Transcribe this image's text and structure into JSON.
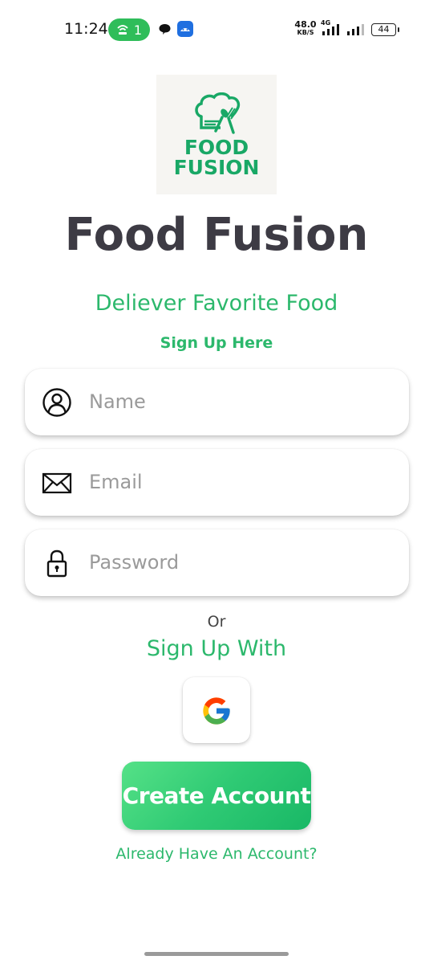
{
  "status_bar": {
    "time": "11:24",
    "hotspot_count": "1",
    "net_speed": "48.0",
    "net_speed_unit": "KB/S",
    "network_type": "4G",
    "battery": "44"
  },
  "logo": {
    "line1": "FOOD",
    "line2": "FUSION",
    "brand_color": "#19a866"
  },
  "app_title": "Food Fusion",
  "tagline": "Deliever Favorite Food",
  "signup_heading": "Sign Up Here",
  "form": {
    "name": {
      "placeholder": "Name",
      "icon": "user-circle-icon"
    },
    "email": {
      "placeholder": "Email",
      "icon": "envelope-icon"
    },
    "password": {
      "placeholder": "Password",
      "icon": "lock-icon"
    }
  },
  "or_text": "Or",
  "signup_with": "Sign Up With",
  "social": {
    "google_icon": "google-icon"
  },
  "create_account_label": "Create Account",
  "have_account_link": "Already Have An Account?",
  "colors": {
    "accent": "#2cb86c",
    "title": "#3d3b44",
    "button_start": "#55e187",
    "button_end": "#19b866"
  }
}
